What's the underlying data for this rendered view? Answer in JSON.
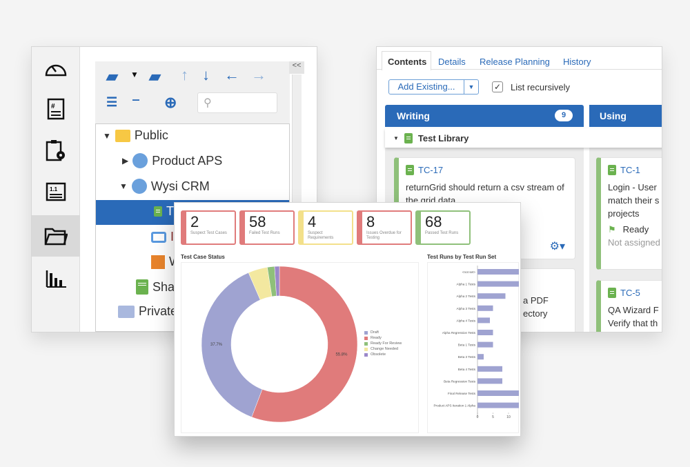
{
  "left_panel": {
    "sidebar": [
      {
        "icon": "dashboard-icon"
      },
      {
        "icon": "requirements-icon"
      },
      {
        "icon": "test-config-icon"
      },
      {
        "icon": "test-steps-icon"
      },
      {
        "icon": "folder-icon",
        "active": true
      },
      {
        "icon": "reports-icon"
      }
    ],
    "collapse_label": "<<",
    "search": {
      "placeholder": "",
      "value": ""
    },
    "tree": [
      {
        "label": "Public",
        "icon": "folder-icon",
        "expanded": true
      },
      {
        "label": "Product APS",
        "icon": "project-icon",
        "expanded": false
      },
      {
        "label": "Wysi CRM",
        "icon": "project-icon",
        "expanded": true
      },
      {
        "label": "T",
        "icon": "test-library-icon",
        "selected": true
      },
      {
        "label": "I",
        "icon": "inbox-icon"
      },
      {
        "label": "W",
        "icon": "work-icon"
      },
      {
        "label": "Sha",
        "icon": "test-library-icon"
      },
      {
        "label": "Private",
        "icon": "folder-icon"
      }
    ]
  },
  "right_panel": {
    "tabs": [
      {
        "label": "Contents",
        "active": true
      },
      {
        "label": "Details"
      },
      {
        "label": "Release Planning"
      },
      {
        "label": "History"
      }
    ],
    "add_existing_label": "Add Existing...",
    "list_recursively": {
      "label": "List recursively",
      "checked": true
    },
    "columns": [
      {
        "title": "Writing",
        "count": "9"
      },
      {
        "title": "Using"
      }
    ],
    "group_label": "Test Library",
    "cards": [
      {
        "id": "TC-17",
        "text": "returnGrid should return a csv stream of the grid data"
      },
      {
        "id": "",
        "text": "a PDF\nectory"
      },
      {
        "id": "TC-1",
        "text": "Login - User match their s projects",
        "status": "Ready",
        "assignee": "Not assigned"
      },
      {
        "id": "TC-5",
        "text": "QA Wizard F Verify that th"
      }
    ]
  },
  "dashboard": {
    "metrics": [
      {
        "value": "2",
        "label": "Suspect Test Cases",
        "color": "#e07b7b"
      },
      {
        "value": "58",
        "label": "Failed Test Runs",
        "color": "#e07b7b"
      },
      {
        "value": "4",
        "label": "Suspect Requirements",
        "color": "#f3e08a"
      },
      {
        "value": "8",
        "label": "Issues Overdue for Testing",
        "color": "#e07b7b"
      },
      {
        "value": "68",
        "label": "Passed Test Runs",
        "color": "#8fc07a"
      }
    ],
    "donut_title": "Test Case Status",
    "bar_title": "Test Runs by Test Run Set"
  },
  "chart_data": [
    {
      "type": "pie",
      "title": "Test Case Status",
      "donut": true,
      "slices": [
        {
          "name": "Ready",
          "value": 55.8,
          "color": "#e07b7b",
          "label": "55.8%"
        },
        {
          "name": "Draft",
          "value": 37.7,
          "color": "#9fa3d1",
          "label": "37.7%"
        },
        {
          "name": "Change Needed",
          "value": 4.0,
          "color": "#f3e8a0"
        },
        {
          "name": "Ready For Review",
          "value": 1.5,
          "color": "#8fc07a"
        },
        {
          "name": "Obsolete",
          "value": 1.0,
          "color": "#9b88c9"
        }
      ],
      "legend": [
        "Draft",
        "Ready",
        "Ready For Review",
        "Change Needed",
        "Obsolete"
      ],
      "legend_colors": [
        "#9fa3d1",
        "#e07b7b",
        "#8fc07a",
        "#f3e8a0",
        "#9b88c9"
      ],
      "legend_placement": "right"
    },
    {
      "type": "bar",
      "orientation": "horizontal",
      "title": "Test Runs by Test Run Set",
      "categories": [
        "<not set>",
        "Alpha 1 Tests",
        "Alpha 2 Tests",
        "Alpha 3 Tests",
        "Alpha 4 Tests",
        "Alpha Regression Tests",
        "Beta 1 Tests",
        "Beta 3 Tests",
        "Beta 4 Tests",
        "Beta Regression Tests",
        "Final Release Tests",
        "Product APS Iteration 1 Alpha"
      ],
      "values": [
        14,
        14,
        9,
        5,
        4,
        5,
        5,
        2,
        8,
        8,
        14,
        14
      ],
      "xticks": [
        "0",
        "5",
        "10"
      ],
      "xlim": [
        0,
        13
      ],
      "color": "#9fa3d1"
    }
  ]
}
